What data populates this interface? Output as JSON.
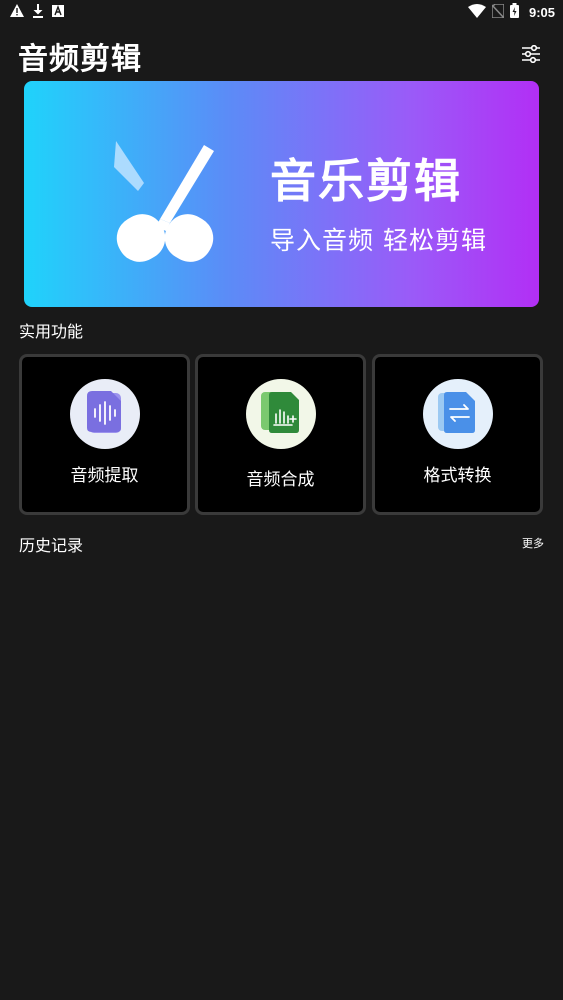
{
  "status_bar": {
    "time": "9:05",
    "left_icons": [
      "warning-icon",
      "download-icon",
      "font-icon"
    ],
    "right_icons": [
      "wifi-icon",
      "no-sim-icon",
      "battery-icon"
    ]
  },
  "header": {
    "title": "音频剪辑",
    "settings_icon": "sliders-icon"
  },
  "banner": {
    "title": "音乐剪辑",
    "subtitle": "导入音频 轻松剪辑",
    "icon": "scissors-icon",
    "gradient": [
      "#1fd3fb",
      "#5c8bf7",
      "#9a5bf8",
      "#b22ff5"
    ]
  },
  "functions": {
    "heading": "实用功能",
    "items": [
      {
        "label": "音频提取",
        "icon": "audio-wave-file-icon",
        "color": "#7a6fe0"
      },
      {
        "label": "音频合成",
        "icon": "audio-merge-file-icon",
        "color": "#2f8a3a"
      },
      {
        "label": "格式转换",
        "icon": "convert-file-icon",
        "color": "#4a90e8"
      }
    ]
  },
  "history": {
    "heading": "历史记录",
    "more_label": "更多"
  }
}
